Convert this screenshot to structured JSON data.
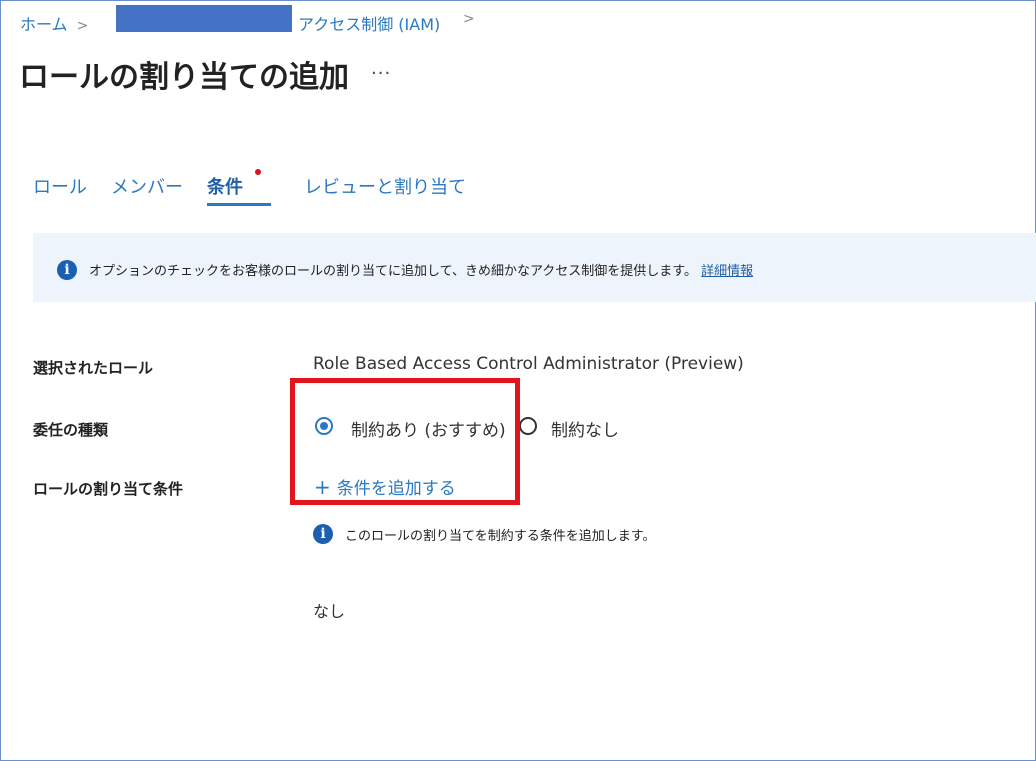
{
  "breadcrumb": {
    "home": "ホーム",
    "separator": ">",
    "iam": "アクセス制御 (IAM)"
  },
  "page": {
    "title": "ロールの割り当ての追加",
    "more": "..."
  },
  "tabs": [
    {
      "label": "ロール"
    },
    {
      "label": "メンバー"
    },
    {
      "label": "条件",
      "active": true
    },
    {
      "label": "レビューと割り当て"
    }
  ],
  "banner": {
    "text": "オプションのチェックをお客様のロールの割り当てに追加して、きめ細かなアクセス制御を提供します。",
    "link": "詳細情報"
  },
  "form": {
    "selected_role_label": "選択されたロール",
    "selected_role_value": "Role Based Access Control Administrator (Preview)",
    "delegation_label": "委任の種類",
    "option_constrained": "制約あり (おすすめ)",
    "option_unconstrained": "制約なし",
    "selected_option": "制約あり (おすすめ)",
    "condition_label": "ロールの割り当て条件",
    "add_condition": "条件を追加する",
    "condition_note": "このロールの割り当てを制約する条件を追加します。",
    "conditions_value": "なし"
  },
  "colors": {
    "accent": "#2b79c2",
    "highlight": "#e3141b",
    "redaction": "#4472c4",
    "banner_bg": "#eef4fb",
    "required_dot": "#d8141a"
  },
  "icons": [
    "info-icon",
    "plus-icon",
    "more-icon"
  ]
}
